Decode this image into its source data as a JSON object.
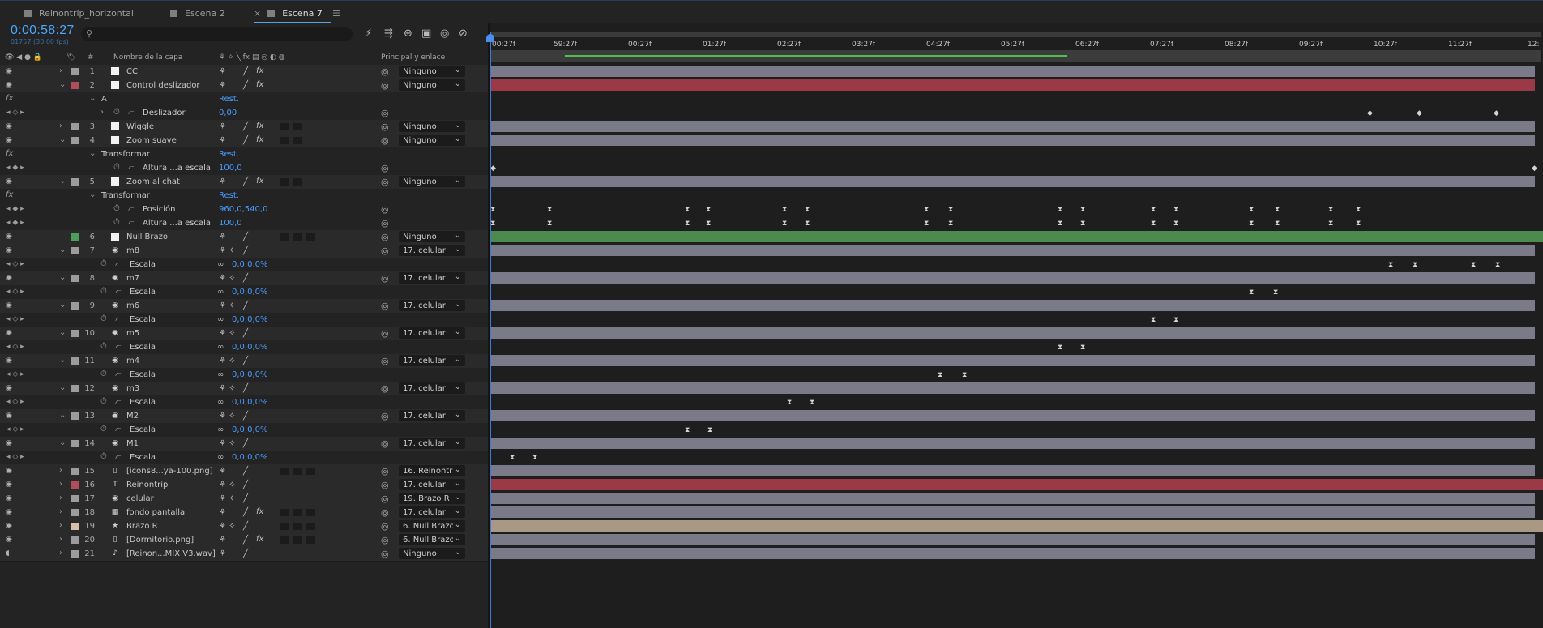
{
  "tabs": [
    {
      "label": "Reinontrip_horizontal"
    },
    {
      "label": "Escena 2"
    },
    {
      "label": "Escena 7",
      "close": "×",
      "menu": "☰"
    }
  ],
  "timecode": "0:00:58:27",
  "fps_readout": "01757 (30.00 fps)",
  "header": {
    "col_num": "#",
    "col_name": "Nombre de la capa",
    "col_parent": "Principal y enlace"
  },
  "ruler_ticks": [
    "00:27f",
    "59:27f",
    "00:27f",
    "01:27f",
    "02:27f",
    "03:27f",
    "04:27f",
    "05:27f",
    "06:27f",
    "07:27f",
    "08:27f",
    "09:27f",
    "10:27f",
    "11:27f",
    "12:"
  ],
  "layers": [
    {
      "num": "1",
      "name": "CC",
      "parent": "Ninguno"
    },
    {
      "num": "2",
      "name": "Control deslizador",
      "parent": "Ninguno"
    },
    {
      "num": "3",
      "name": "Wiggle",
      "parent": "Ninguno"
    },
    {
      "num": "4",
      "name": "Zoom suave",
      "parent": "Ninguno"
    },
    {
      "num": "5",
      "name": "Zoom al chat",
      "parent": "Ninguno"
    },
    {
      "num": "6",
      "name": "Null Brazo",
      "parent": "Ninguno"
    },
    {
      "num": "7",
      "name": "m8",
      "parent": "17. celular"
    },
    {
      "num": "8",
      "name": "m7",
      "parent": "17. celular"
    },
    {
      "num": "9",
      "name": "m6",
      "parent": "17. celular"
    },
    {
      "num": "10",
      "name": "m5",
      "parent": "17. celular"
    },
    {
      "num": "11",
      "name": "m4",
      "parent": "17. celular"
    },
    {
      "num": "12",
      "name": "m3",
      "parent": "17. celular"
    },
    {
      "num": "13",
      "name": "M2",
      "parent": "17. celular"
    },
    {
      "num": "14",
      "name": "M1",
      "parent": "17. celular"
    },
    {
      "num": "15",
      "name": "[icons8...ya-100.png]",
      "parent": "16. Reinontr"
    },
    {
      "num": "16",
      "name": "Reinontrip",
      "parent": "17. celular"
    },
    {
      "num": "17",
      "name": "celular",
      "parent": "19. Brazo R"
    },
    {
      "num": "18",
      "name": "fondo pantalla",
      "parent": "17. celular"
    },
    {
      "num": "19",
      "name": "Brazo R",
      "parent": "6. Null Brazo"
    },
    {
      "num": "20",
      "name": "[Dormitorio.png]",
      "parent": "6. Null Brazo"
    },
    {
      "num": "21",
      "name": "[Reinon...MIX V3.wav]",
      "parent": "Ninguno"
    }
  ],
  "props": {
    "a": "A",
    "rest": "Rest.",
    "deslizador": "Deslizador",
    "deslizador_val": "0,00",
    "transformar": "Transformar",
    "altura": "Altura ...a escala",
    "altura_val": "100,0",
    "posicion": "Posición",
    "posicion_val": "960,0,540,0",
    "escala": "Escala",
    "escala_val": "0,0,0,0%"
  },
  "colors": {
    "accent": "#4a9bff",
    "red_bar": "#9b3a46",
    "gray_bar": "#7a7a8a",
    "green_bar": "#4d8a4d",
    "tan_bar": "#a89884"
  }
}
